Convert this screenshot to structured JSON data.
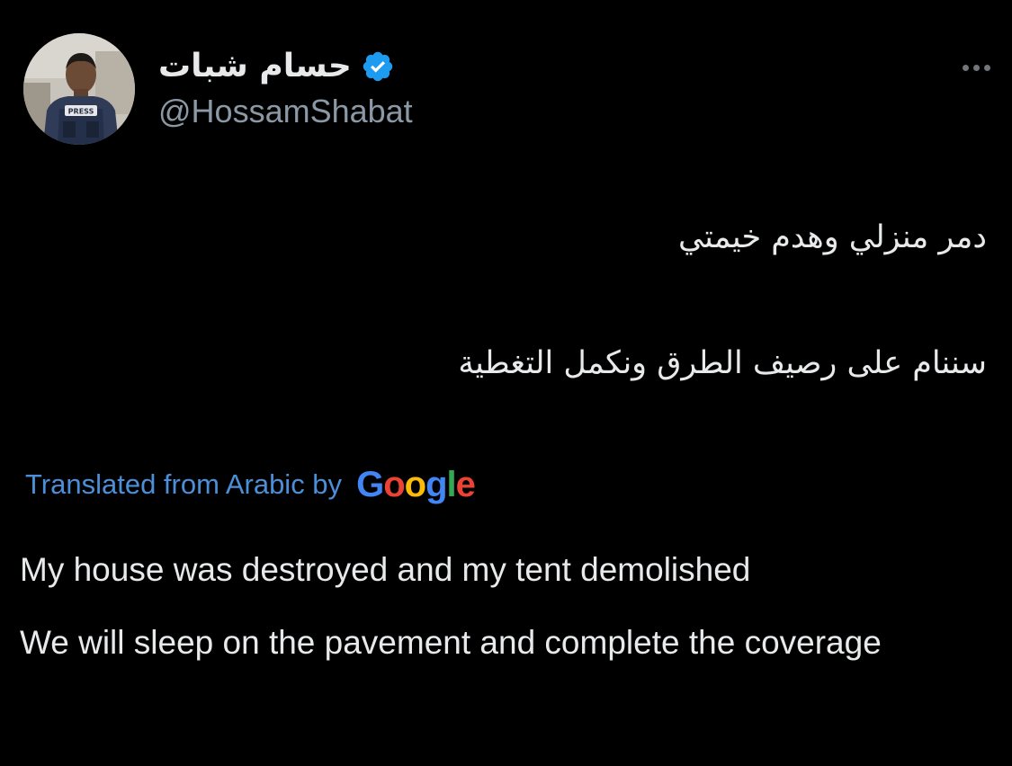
{
  "author": {
    "display_name": "حسام شبات",
    "handle": "@HossamShabat",
    "verified": true,
    "avatar_badge_text": "PRESS"
  },
  "tweet": {
    "original_lines": [
      "دمر منزلي وهدم خيمتي",
      "سننام على رصيف الطرق ونكمل التغطية"
    ],
    "translation_label": "Translated from Arabic by",
    "translation_provider": "Google",
    "translated_lines": [
      "My house was destroyed and my tent demolished",
      "We will sleep on the pavement and complete the coverage"
    ]
  },
  "icons": {
    "verified": "verified-badge-icon",
    "more": "more-options-icon"
  },
  "colors": {
    "background": "#000000",
    "text_primary": "#e7e9ea",
    "text_secondary": "#8b98a5",
    "link": "#4b8fd9",
    "verified_blue": "#1d9bf0"
  }
}
